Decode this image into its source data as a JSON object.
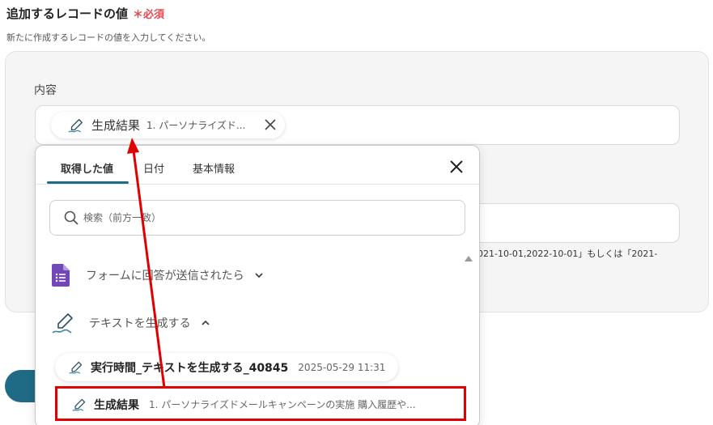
{
  "section": {
    "title": "追加するレコードの値",
    "required": "＊必須",
    "description": "新たに作成するレコードの値を入力してください。"
  },
  "field": {
    "label": "内容",
    "hint": "021-10-01,2022-10-01」もしくは「2021-"
  },
  "chip": {
    "label": "生成結果",
    "value": "1. パーソナライズド..."
  },
  "dropdown": {
    "tabs": [
      {
        "label": "取得した値",
        "active": true
      },
      {
        "label": "日付",
        "active": false
      },
      {
        "label": "基本情報",
        "active": false
      }
    ],
    "search_placeholder": "検索（前方一致）",
    "groups": [
      {
        "label": "フォームに回答が送信されたら",
        "expanded": false,
        "icon": "google-forms-icon"
      },
      {
        "label": "テキストを生成する",
        "expanded": true,
        "icon": "ai-text-pen-icon"
      }
    ],
    "items": [
      {
        "label": "実行時間_テキストを生成する_40845",
        "value": "2025-05-29 11:31"
      },
      {
        "label": "生成結果",
        "value": "1. パーソナライズドメールキャンペーンの実施 購入履歴や..."
      }
    ]
  },
  "colors": {
    "accent": "#1f6b85",
    "required": "#e5484d",
    "annotation": "#e00000",
    "forms_purple": "#7248b9"
  }
}
